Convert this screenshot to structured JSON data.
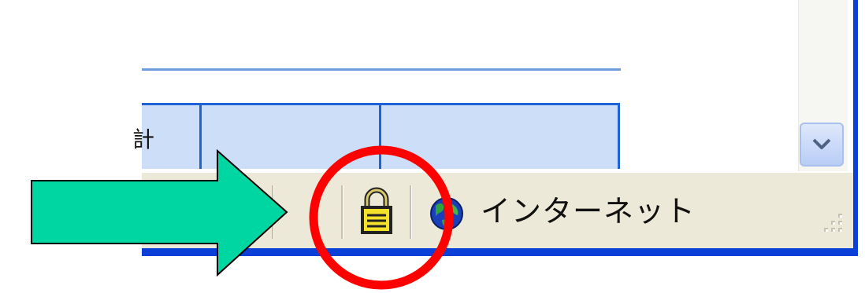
{
  "table": {
    "cells": [
      "計",
      "",
      ""
    ]
  },
  "statusbar": {
    "security_icon": "lock-icon",
    "zone_icon": "globe-icon",
    "zone_label": "インターネット"
  },
  "scrollbar": {
    "down_icon": "chevron-down-icon"
  },
  "annotations": {
    "arrow_color": "#00d6a2",
    "circle_color": "#ff0000"
  },
  "colors": {
    "window_border": "#0a3fd8",
    "table_fill": "#cddff8",
    "table_border": "#1f62d6",
    "statusbar": "#ece9d8"
  }
}
